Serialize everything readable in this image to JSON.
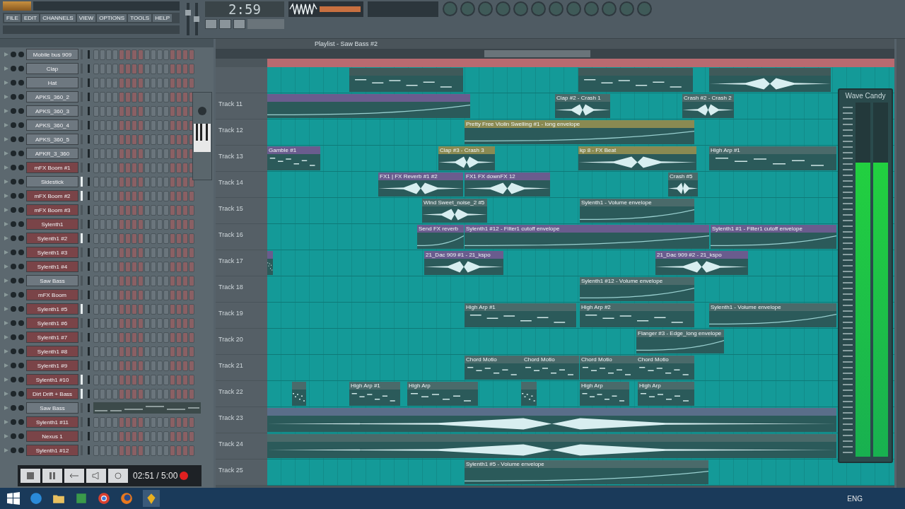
{
  "toolbar": {
    "menu": [
      "FILE",
      "EDIT",
      "CHANNELS",
      "VIEW",
      "OPTIONS",
      "TOOLS",
      "HELP"
    ],
    "master_volume": {
      "level": 0.75
    },
    "master_pitch": {
      "level": 0.5
    },
    "time": "2:59"
  },
  "channel_rack": {
    "channels": [
      {
        "name": "Mobile bus 909",
        "color": "#6e7880",
        "selected": false,
        "kind": "steps"
      },
      {
        "name": "Clap",
        "color": "#6e7880",
        "selected": false,
        "kind": "steps"
      },
      {
        "name": "Hat",
        "color": "#6e7880",
        "selected": false,
        "kind": "steps"
      },
      {
        "name": "APKS_360_2",
        "color": "#6e7880",
        "selected": false,
        "kind": "steps"
      },
      {
        "name": "APKS_360_3",
        "color": "#6e7880",
        "selected": false,
        "kind": "steps"
      },
      {
        "name": "APKS_360_4",
        "color": "#6e7880",
        "selected": false,
        "kind": "steps"
      },
      {
        "name": "APKS_360_5",
        "color": "#6e7880",
        "selected": false,
        "kind": "steps"
      },
      {
        "name": "APKR_3_360",
        "color": "#6e7880",
        "selected": false,
        "kind": "steps"
      },
      {
        "name": "mFX Boom #1",
        "color": "#7a4448",
        "selected": false,
        "kind": "steps"
      },
      {
        "name": "Sidestick",
        "color": "#6e7880",
        "selected": true,
        "kind": "steps"
      },
      {
        "name": "mFX Boom #2",
        "color": "#7a4448",
        "selected": true,
        "kind": "steps"
      },
      {
        "name": "mFX Boom #3",
        "color": "#7a4448",
        "selected": false,
        "kind": "steps"
      },
      {
        "name": "Sylenth1",
        "color": "#7a4448",
        "selected": false,
        "kind": "steps"
      },
      {
        "name": "Sylenth1 #2",
        "color": "#7a4448",
        "selected": true,
        "kind": "steps"
      },
      {
        "name": "Sylenth1 #3",
        "color": "#7a4448",
        "selected": false,
        "kind": "steps"
      },
      {
        "name": "Sylenth1 #4",
        "color": "#7a4448",
        "selected": false,
        "kind": "steps"
      },
      {
        "name": "Saw Bass",
        "color": "#6e7880",
        "selected": false,
        "kind": "steps"
      },
      {
        "name": "mFX Boom",
        "color": "#7a4448",
        "selected": false,
        "kind": "steps"
      },
      {
        "name": "Sylenth1 #5",
        "color": "#7a4448",
        "selected": true,
        "kind": "steps"
      },
      {
        "name": "Sylenth1 #6",
        "color": "#7a4448",
        "selected": false,
        "kind": "steps"
      },
      {
        "name": "Sylenth1 #7",
        "color": "#7a4448",
        "selected": false,
        "kind": "steps"
      },
      {
        "name": "Sylenth1 #8",
        "color": "#7a4448",
        "selected": false,
        "kind": "steps"
      },
      {
        "name": "Sylenth1 #9",
        "color": "#7a4448",
        "selected": false,
        "kind": "steps"
      },
      {
        "name": "Sylenth1 #10",
        "color": "#7a4448",
        "selected": true,
        "kind": "steps"
      },
      {
        "name": "Dirt Drift + Bass",
        "color": "#7a4448",
        "selected": true,
        "kind": "steps"
      },
      {
        "name": "Saw Bass",
        "color": "#6e7880",
        "selected": false,
        "kind": "pianoroll"
      },
      {
        "name": "Sylenth1 #11",
        "color": "#7a4448",
        "selected": false,
        "kind": "steps"
      },
      {
        "name": "Nexus 1",
        "color": "#7a4448",
        "selected": false,
        "kind": "steps"
      },
      {
        "name": "Sylenth1 #12",
        "color": "#7a4448",
        "selected": false,
        "kind": "steps"
      }
    ]
  },
  "playlist": {
    "title": "Playlist - Saw Bass #2",
    "tracks": [
      {
        "clips": [
          {
            "kind": "pattern"
          },
          {
            "kind": "pattern"
          },
          {
            "kind": "audio"
          }
        ]
      },
      {
        "name": "Track 11",
        "clips": [
          {
            "kind": "automation",
            "color": "#6a5c8e"
          },
          {
            "label": "Clap #2 - Crash 1",
            "kind": "audio",
            "color": "#4a6a6a"
          },
          {
            "label": "Crash #2 - Crash 2",
            "kind": "audio",
            "color": "#4a6a6a"
          }
        ]
      },
      {
        "name": "Track 12",
        "clips": [
          {
            "label": "Pretty Free Violin Swelling #1 - long envelope",
            "kind": "automation",
            "color": "#8a8a52"
          }
        ]
      },
      {
        "name": "Track 13",
        "clips": [
          {
            "label": "Gamble #1",
            "kind": "pattern",
            "color": "#6a5c8e"
          },
          {
            "label": "Clap #3 - Crash 3",
            "kind": "audio",
            "color": "#8a8a52"
          },
          {
            "label": "kp 8 - FX Beat",
            "kind": "audio",
            "color": "#8a8a52"
          },
          {
            "label": "High Arp #1",
            "kind": "pattern",
            "color": "#4a6a6a"
          }
        ]
      },
      {
        "name": "Track 14",
        "clips": [
          {
            "label": "FX1 | FX Reverb #1 #2",
            "kind": "audio",
            "color": "#6a5c8e"
          },
          {
            "label": "FX1 FX downFX 12",
            "kind": "audio",
            "color": "#6a5c8e"
          },
          {
            "label": "Crash #5",
            "kind": "audio",
            "color": "#4a6a6a"
          }
        ]
      },
      {
        "name": "Track 15",
        "clips": [
          {
            "label": "Wind Sweet_noise_2 #5",
            "kind": "audio",
            "color": "#4a6a6a"
          },
          {
            "label": "Sylenth1 - Volume envelope",
            "kind": "automation",
            "color": "#4a6a6a"
          }
        ]
      },
      {
        "name": "Track 16",
        "clips": [
          {
            "label": "Send FX reverb",
            "kind": "automation",
            "color": "#6a5c8e"
          },
          {
            "label": "Sylenth1 #12 - Filter1 cutoff envelope",
            "kind": "automation",
            "color": "#6a5c8e"
          },
          {
            "label": "Sylenth1 #1 - Filter1 cutoff envelope",
            "kind": "automation",
            "color": "#6a5c8e"
          }
        ]
      },
      {
        "name": "Track 17",
        "clips": [
          {
            "kind": "pattern",
            "color": "#6a5c8e"
          },
          {
            "label": "21_Dac 909 #1 - 21_kspo",
            "kind": "audio",
            "color": "#6a5c8e"
          },
          {
            "label": "21_Dac 909 #2 - 21_kspo",
            "kind": "audio",
            "color": "#6a5c8e"
          }
        ]
      },
      {
        "name": "Track 18",
        "clips": [
          {
            "label": "Sylenth1 #12 - Volume envelope",
            "kind": "automation",
            "color": "#4a6a6a"
          }
        ]
      },
      {
        "name": "Track 19",
        "clips": [
          {
            "label": "High Arp #1",
            "kind": "pattern",
            "color": "#4a6a6a"
          },
          {
            "label": "High Arp #2",
            "kind": "pattern",
            "color": "#4a6a6a"
          },
          {
            "label": "Sylenth1 - Volume envelope",
            "kind": "automation",
            "color": "#4a6a6a"
          }
        ]
      },
      {
        "name": "Track 20",
        "clips": [
          {
            "label": "Flanger #3 - Edge_long envelope",
            "kind": "automation",
            "color": "#4a6a6a"
          }
        ]
      },
      {
        "name": "Track 21",
        "clips": [
          {
            "label": "Chord Motio",
            "kind": "pattern",
            "color": "#4a6a6a"
          },
          {
            "label": "Chord Motio",
            "kind": "pattern",
            "color": "#4a6a6a"
          },
          {
            "label": "Chord Motio",
            "kind": "pattern",
            "color": "#4a6a6a"
          },
          {
            "label": "Chord Motio",
            "kind": "pattern",
            "color": "#4a6a6a"
          }
        ]
      },
      {
        "name": "Track 22",
        "clips": [
          {
            "kind": "pattern",
            "color": "#4a6a6a"
          },
          {
            "label": "High Arp #1",
            "kind": "pattern",
            "color": "#4a6a6a"
          },
          {
            "label": "High Arp",
            "kind": "pattern",
            "color": "#4a6a6a"
          },
          {
            "kind": "pattern",
            "color": "#4a6a6a"
          },
          {
            "label": "High Arp",
            "kind": "pattern",
            "color": "#4a6a6a"
          },
          {
            "label": "High Arp",
            "kind": "pattern",
            "color": "#4a6a6a"
          }
        ]
      },
      {
        "name": "Track 23",
        "clips": [
          {
            "kind": "audio",
            "color": "#5a6e8a"
          }
        ]
      },
      {
        "name": "Track 24",
        "clips": [
          {
            "kind": "audio",
            "color": "#4a6a6a"
          }
        ]
      },
      {
        "name": "Track 25",
        "clips": [
          {
            "label": "Sylenth1 #5 - Volume envelope",
            "kind": "automation",
            "color": "#4a6a6a"
          }
        ]
      }
    ]
  },
  "wave_candy": {
    "title": "Wave Candy",
    "channels": [
      {
        "level": 0.83
      },
      {
        "level": 0.83
      }
    ]
  },
  "recorder": {
    "elapsed": "02:51 / 5:00",
    "recording": true
  },
  "taskbar": {
    "language": "ENG"
  }
}
